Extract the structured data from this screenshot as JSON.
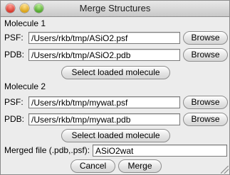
{
  "window": {
    "title": "Merge Structures"
  },
  "molecule1": {
    "heading": "Molecule 1",
    "psf_label": "PSF:",
    "psf_value": "/Users/rkb/tmp/ASiO2.psf",
    "pdb_label": "PDB:",
    "pdb_value": "/Users/rkb/tmp/ASiO2.pdb",
    "browse_label": "Browse",
    "select_label": "Select loaded molecule"
  },
  "molecule2": {
    "heading": "Molecule 2",
    "psf_label": "PSF:",
    "psf_value": "/Users/rkb/tmp/mywat.psf",
    "pdb_label": "PDB:",
    "pdb_value": "/Users/rkb/tmp/mywat.pdb",
    "browse_label": "Browse",
    "select_label": "Select loaded molecule"
  },
  "merged": {
    "label": "Merged file (.pdb,.psf):",
    "value": "ASiO2wat"
  },
  "actions": {
    "cancel_label": "Cancel",
    "merge_label": "Merge"
  }
}
